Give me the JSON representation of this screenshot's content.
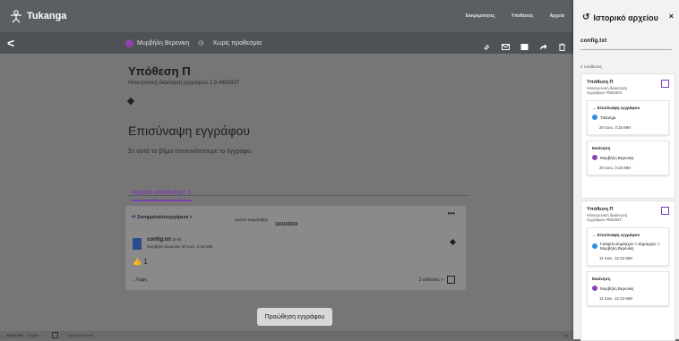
{
  "app": {
    "name": "Tukanga"
  },
  "topnav": [
    "Εκκρεμότητες",
    "Υποθέσεις",
    "Αρχεία"
  ],
  "breadcrumb": {
    "assignee": "Μυρβήλη Βερενίκη",
    "due": "Χωρίς προθεσμία"
  },
  "case": {
    "title": "Υπόθεση Π",
    "subtitle": "Ηλεκτρονική διακίνηση εγγράφων  1.9  #662837"
  },
  "step": {
    "title": "Επισύναψη εγγράφου",
    "description": "Σε αυτό το βήμα επισυνάπτουμε το έγγραφο."
  },
  "files_tab": "Αρχεία υπόθεσης: 1",
  "file_card": {
    "path": "Συνημμένα/εισερχόμενα  >",
    "date_label": "Ημ/νία παραλαβής",
    "date_colon": ":",
    "date_value": "10/10/2019",
    "more": "•••",
    "file_name": "config.txt",
    "file_size": "(9 B)",
    "file_meta": "Μυρβήλη Βερενίκη  20 Ιουν, 2:33 ΜΜ",
    "likes": "1",
    "download": "Λήψη",
    "versions": "2 εκδόσεις  >"
  },
  "proceed_button": "Προώθηση εγγράφου",
  "footer": {
    "lang_el": "Ελληνικά",
    "lang_en": "English",
    "contrast": "Υψηλή αντίθεση",
    "version": "Ορ"
  },
  "panel": {
    "title": "Ιστορικό αρχείου",
    "close": "×",
    "file": "config.txt",
    "count": "2 υποθέσεις",
    "cases": [
      {
        "title": "Υπόθεση Π",
        "subtitle": "Ηλεκτρονική διακίνηση εγγράφων  #681604",
        "events": [
          {
            "title": "→  Επισύναψη εγγράφου",
            "who": "Tukanga",
            "color": "#2f8fe0",
            "date": "20 Ιουν, 3:15 ΜΜ"
          },
          {
            "title": "Εκκίνηση",
            "who": "Μυρβήλη Βερενίκη",
            "color": "#8e44ad",
            "date": "20 Ιουν, 3:15 ΜΜ"
          }
        ]
      },
      {
        "title": "Υπόθεση Π",
        "subtitle": "Ηλεκτρονική διακίνηση εγγράφων  #662837",
        "events": [
          {
            "title": "→  Επισύναψη εγγράφου",
            "who": "Γραφείο Δημάρχου > Δήμαρχος > Μυρβήλη Βερενίκη",
            "color": "#2f8fe0",
            "date": "11 Ιουν, 12:13 ΜΜ"
          },
          {
            "title": "Εκκίνηση",
            "who": "Μυρβήλη Βερενίκη",
            "color": "#8e44ad",
            "date": "11 Ιουν, 12:13 ΜΜ"
          }
        ]
      }
    ]
  },
  "colors": {
    "accent": "#7b3fb0",
    "topbar": "#5b5e62",
    "overlay": "#767676"
  }
}
